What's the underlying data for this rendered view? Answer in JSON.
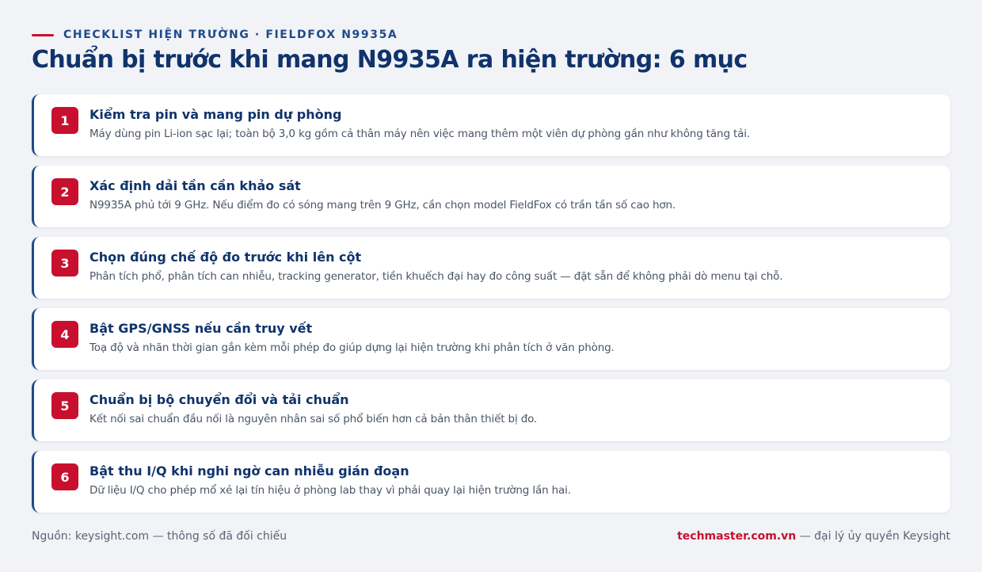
{
  "header": {
    "eyebrow": "CHECKLIST HIỆN TRƯỜNG · FIELDFOX N9935A",
    "title": "Chuẩn bị trước khi mang N9935A ra hiện trường: 6 mục"
  },
  "items": [
    {
      "number": "1",
      "title": "Kiểm tra pin và mang pin dự phòng",
      "description": "Máy dùng pin Li-ion sạc lại; toàn bộ 3,0 kg gồm cả thân máy nên việc mang thêm một viên dự phòng gần như không tăng tải."
    },
    {
      "number": "2",
      "title": "Xác định dải tần cần khảo sát",
      "description": "N9935A phủ tới 9 GHz. Nếu điểm đo có sóng mang trên 9 GHz, cần chọn model FieldFox có trần tần số cao hơn."
    },
    {
      "number": "3",
      "title": "Chọn đúng chế độ đo trước khi lên cột",
      "description": "Phân tích phổ, phân tích can nhiễu, tracking generator, tiền khuếch đại hay đo công suất — đặt sẵn để không phải dò menu tại chỗ."
    },
    {
      "number": "4",
      "title": "Bật GPS/GNSS nếu cần truy vết",
      "description": "Toạ độ và nhãn thời gian gắn kèm mỗi phép đo giúp dựng lại hiện trường khi phân tích ở văn phòng."
    },
    {
      "number": "5",
      "title": "Chuẩn bị bộ chuyển đổi và tải chuẩn",
      "description": "Kết nối sai chuẩn đầu nối là nguyên nhân sai số phổ biến hơn cả bản thân thiết bị đo."
    },
    {
      "number": "6",
      "title": "Bật thu I/Q khi nghi ngờ can nhiễu gián đoạn",
      "description": "Dữ liệu I/Q cho phép mổ xẻ lại tín hiệu ở phòng lab thay vì phải quay lại hiện trường lần hai."
    }
  ],
  "footer": {
    "source": "Nguồn: keysight.com — thông số đã đối chiếu",
    "brand": "techmaster.com.vn",
    "tagline": " — đại lý ủy quyền Keysight"
  },
  "colors": {
    "accent": "#c8102e",
    "navy": "#10336b",
    "background": "#f1f3f7"
  }
}
